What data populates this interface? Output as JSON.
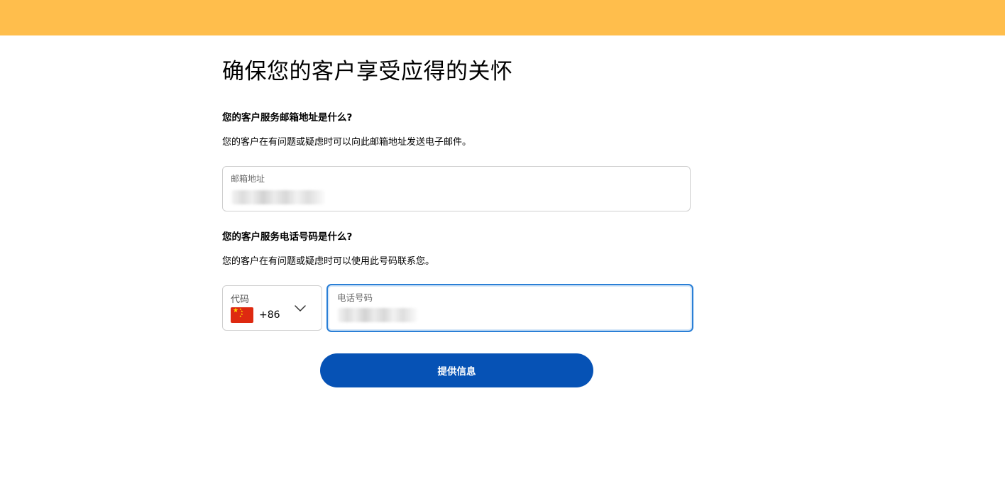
{
  "colors": {
    "top_bar": "#ffbe4c",
    "primary_button": "#0652b5",
    "focus_border": "#2a7fd6",
    "field_border": "#cfcfcf",
    "flag_red": "#de2910",
    "flag_star": "#ffde00"
  },
  "page": {
    "title": "确保您的客户享受应得的关怀"
  },
  "email_section": {
    "question": "您的客户服务邮箱地址是什么?",
    "description": "您的客户在有问题或疑虑时可以向此邮箱地址发送电子邮件。",
    "field_label": "邮箱地址",
    "value_state": "blurred"
  },
  "phone_section": {
    "question": "您的客户服务电话号码是什么?",
    "description": "您的客户在有问题或疑虑时可以使用此号码联系您。",
    "code_label": "代码",
    "selected_country_flag_icon": "china-flag-icon",
    "selected_code": "+86",
    "dropdown_icon": "chevron-down-icon",
    "phone_label": "电话号码",
    "value_state": "blurred",
    "phone_focused": true
  },
  "submit": {
    "label": "提供信息"
  }
}
